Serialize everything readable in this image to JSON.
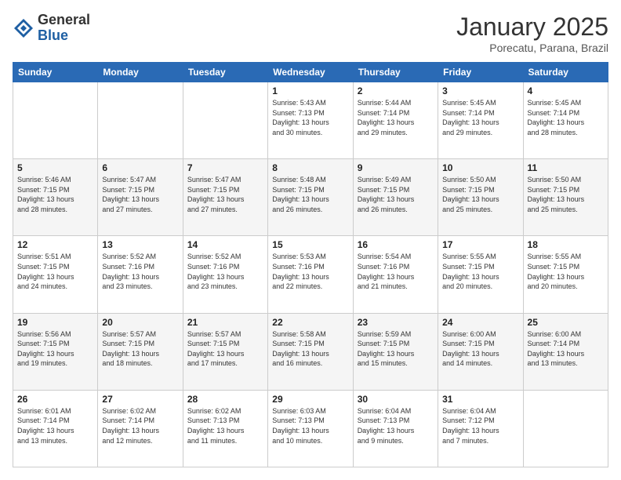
{
  "logo": {
    "general": "General",
    "blue": "Blue"
  },
  "header": {
    "month": "January 2025",
    "location": "Porecatu, Parana, Brazil"
  },
  "weekdays": [
    "Sunday",
    "Monday",
    "Tuesday",
    "Wednesday",
    "Thursday",
    "Friday",
    "Saturday"
  ],
  "weeks": [
    [
      {
        "day": "",
        "info": ""
      },
      {
        "day": "",
        "info": ""
      },
      {
        "day": "",
        "info": ""
      },
      {
        "day": "1",
        "info": "Sunrise: 5:43 AM\nSunset: 7:13 PM\nDaylight: 13 hours\nand 30 minutes."
      },
      {
        "day": "2",
        "info": "Sunrise: 5:44 AM\nSunset: 7:14 PM\nDaylight: 13 hours\nand 29 minutes."
      },
      {
        "day": "3",
        "info": "Sunrise: 5:45 AM\nSunset: 7:14 PM\nDaylight: 13 hours\nand 29 minutes."
      },
      {
        "day": "4",
        "info": "Sunrise: 5:45 AM\nSunset: 7:14 PM\nDaylight: 13 hours\nand 28 minutes."
      }
    ],
    [
      {
        "day": "5",
        "info": "Sunrise: 5:46 AM\nSunset: 7:15 PM\nDaylight: 13 hours\nand 28 minutes."
      },
      {
        "day": "6",
        "info": "Sunrise: 5:47 AM\nSunset: 7:15 PM\nDaylight: 13 hours\nand 27 minutes."
      },
      {
        "day": "7",
        "info": "Sunrise: 5:47 AM\nSunset: 7:15 PM\nDaylight: 13 hours\nand 27 minutes."
      },
      {
        "day": "8",
        "info": "Sunrise: 5:48 AM\nSunset: 7:15 PM\nDaylight: 13 hours\nand 26 minutes."
      },
      {
        "day": "9",
        "info": "Sunrise: 5:49 AM\nSunset: 7:15 PM\nDaylight: 13 hours\nand 26 minutes."
      },
      {
        "day": "10",
        "info": "Sunrise: 5:50 AM\nSunset: 7:15 PM\nDaylight: 13 hours\nand 25 minutes."
      },
      {
        "day": "11",
        "info": "Sunrise: 5:50 AM\nSunset: 7:15 PM\nDaylight: 13 hours\nand 25 minutes."
      }
    ],
    [
      {
        "day": "12",
        "info": "Sunrise: 5:51 AM\nSunset: 7:15 PM\nDaylight: 13 hours\nand 24 minutes."
      },
      {
        "day": "13",
        "info": "Sunrise: 5:52 AM\nSunset: 7:16 PM\nDaylight: 13 hours\nand 23 minutes."
      },
      {
        "day": "14",
        "info": "Sunrise: 5:52 AM\nSunset: 7:16 PM\nDaylight: 13 hours\nand 23 minutes."
      },
      {
        "day": "15",
        "info": "Sunrise: 5:53 AM\nSunset: 7:16 PM\nDaylight: 13 hours\nand 22 minutes."
      },
      {
        "day": "16",
        "info": "Sunrise: 5:54 AM\nSunset: 7:16 PM\nDaylight: 13 hours\nand 21 minutes."
      },
      {
        "day": "17",
        "info": "Sunrise: 5:55 AM\nSunset: 7:15 PM\nDaylight: 13 hours\nand 20 minutes."
      },
      {
        "day": "18",
        "info": "Sunrise: 5:55 AM\nSunset: 7:15 PM\nDaylight: 13 hours\nand 20 minutes."
      }
    ],
    [
      {
        "day": "19",
        "info": "Sunrise: 5:56 AM\nSunset: 7:15 PM\nDaylight: 13 hours\nand 19 minutes."
      },
      {
        "day": "20",
        "info": "Sunrise: 5:57 AM\nSunset: 7:15 PM\nDaylight: 13 hours\nand 18 minutes."
      },
      {
        "day": "21",
        "info": "Sunrise: 5:57 AM\nSunset: 7:15 PM\nDaylight: 13 hours\nand 17 minutes."
      },
      {
        "day": "22",
        "info": "Sunrise: 5:58 AM\nSunset: 7:15 PM\nDaylight: 13 hours\nand 16 minutes."
      },
      {
        "day": "23",
        "info": "Sunrise: 5:59 AM\nSunset: 7:15 PM\nDaylight: 13 hours\nand 15 minutes."
      },
      {
        "day": "24",
        "info": "Sunrise: 6:00 AM\nSunset: 7:15 PM\nDaylight: 13 hours\nand 14 minutes."
      },
      {
        "day": "25",
        "info": "Sunrise: 6:00 AM\nSunset: 7:14 PM\nDaylight: 13 hours\nand 13 minutes."
      }
    ],
    [
      {
        "day": "26",
        "info": "Sunrise: 6:01 AM\nSunset: 7:14 PM\nDaylight: 13 hours\nand 13 minutes."
      },
      {
        "day": "27",
        "info": "Sunrise: 6:02 AM\nSunset: 7:14 PM\nDaylight: 13 hours\nand 12 minutes."
      },
      {
        "day": "28",
        "info": "Sunrise: 6:02 AM\nSunset: 7:13 PM\nDaylight: 13 hours\nand 11 minutes."
      },
      {
        "day": "29",
        "info": "Sunrise: 6:03 AM\nSunset: 7:13 PM\nDaylight: 13 hours\nand 10 minutes."
      },
      {
        "day": "30",
        "info": "Sunrise: 6:04 AM\nSunset: 7:13 PM\nDaylight: 13 hours\nand 9 minutes."
      },
      {
        "day": "31",
        "info": "Sunrise: 6:04 AM\nSunset: 7:12 PM\nDaylight: 13 hours\nand 7 minutes."
      },
      {
        "day": "",
        "info": ""
      }
    ]
  ]
}
